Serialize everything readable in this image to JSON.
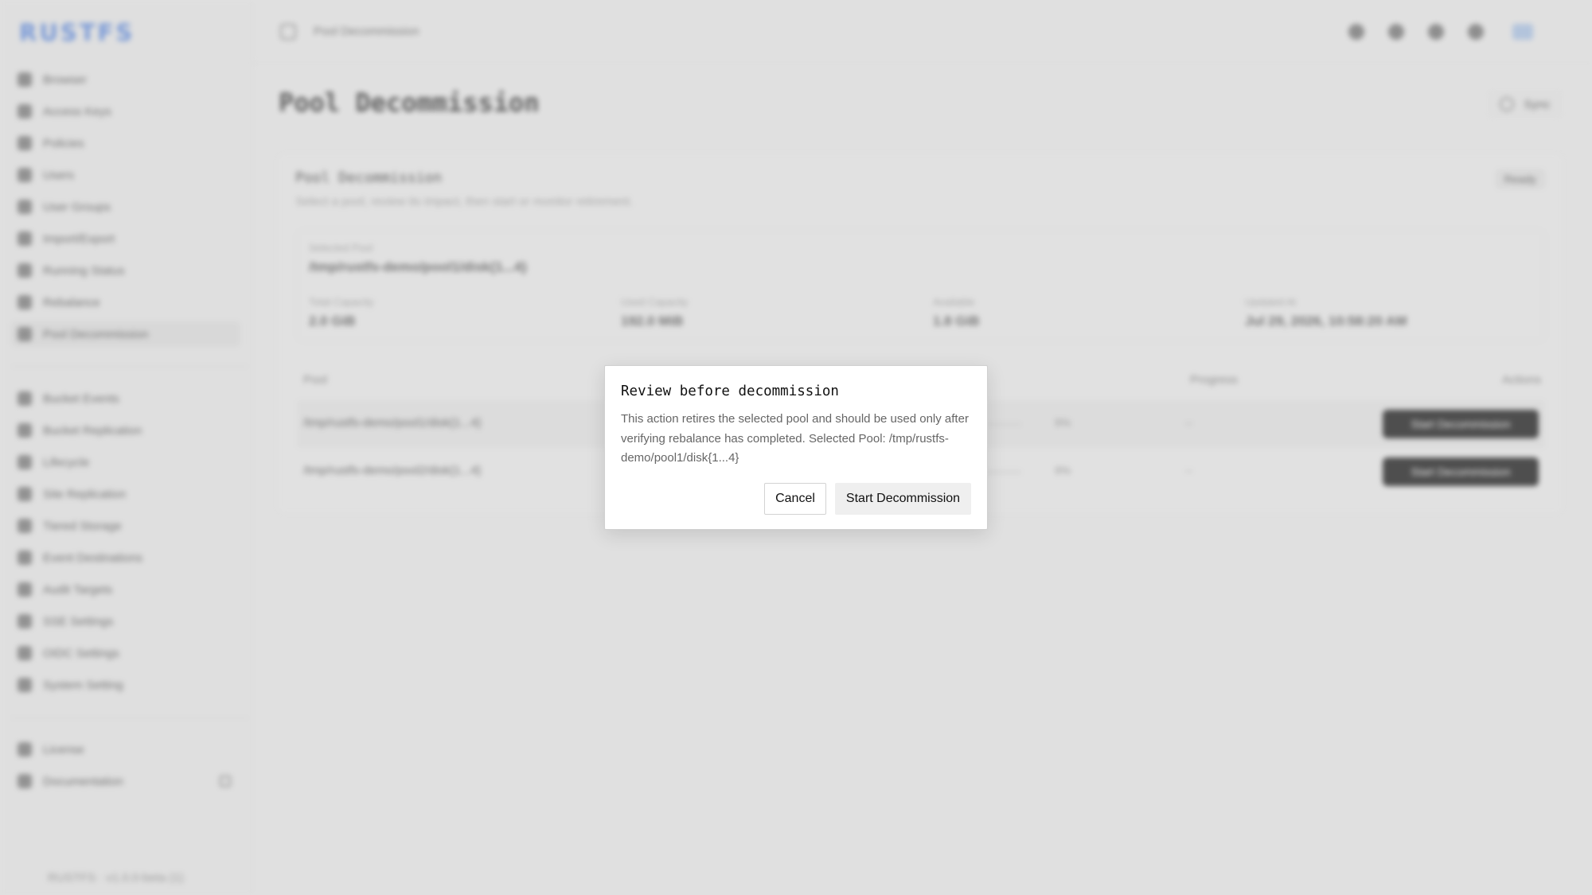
{
  "app": {
    "logo": "RUSTFS",
    "version": "RUSTFS · v1.0.0-beta (1)"
  },
  "sidebar": {
    "items": [
      {
        "label": "Browser"
      },
      {
        "label": "Access Keys"
      },
      {
        "label": "Policies"
      },
      {
        "label": "Users"
      },
      {
        "label": "User Groups"
      },
      {
        "label": "Import/Export"
      },
      {
        "label": "Running Status"
      },
      {
        "label": "Rebalance"
      },
      {
        "label": "Pool Decommission"
      },
      {
        "label": "Bucket Events"
      },
      {
        "label": "Bucket Replication"
      },
      {
        "label": "Lifecycle"
      },
      {
        "label": "Site Replication"
      },
      {
        "label": "Tiered Storage"
      },
      {
        "label": "Event Destinations"
      },
      {
        "label": "Audit Targets"
      },
      {
        "label": "SSE Settings"
      },
      {
        "label": "OIDC Settings"
      },
      {
        "label": "System Setting"
      },
      {
        "label": "License"
      },
      {
        "label": "Documentation"
      }
    ],
    "active_index": 8
  },
  "topbar": {
    "title": "Pool Decommission",
    "avatar": "EN"
  },
  "page": {
    "title": "Pool Decommission",
    "sync_label": "Sync"
  },
  "card": {
    "title": "Pool Decommission",
    "subtitle": "Select a pool, review its impact, then start or monitor retirement.",
    "badge": "Ready",
    "summary": {
      "selected_pool_label": "Selected Pool",
      "selected_pool_value": "/tmp/rustfs-demo/pool1/disk{1...4}",
      "total_capacity_label": "Total Capacity",
      "total_capacity_value": "2.0 GiB",
      "used_capacity_label": "Used Capacity",
      "used_capacity_value": "192.0 MiB",
      "available_label": "Available",
      "available_value": "1.8 GiB",
      "updated_label": "Updated At",
      "updated_value": "Jul 29, 2026, 10:58:20 AM"
    },
    "table": {
      "headers": {
        "pool": "Pool",
        "progress": "Progress",
        "actions": "Actions"
      },
      "rows": [
        {
          "pool": "/tmp/rustfs-demo/pool1/disk{1...4}",
          "usage": "9%",
          "progress": "--",
          "action": "Start Decommission"
        },
        {
          "pool": "/tmp/rustfs-demo/pool2/disk{1...4}",
          "usage": "9%",
          "progress": "--",
          "action": "Start Decommission"
        }
      ]
    }
  },
  "dialog": {
    "title": "Review before decommission",
    "body": "This action retires the selected pool and should be used only after verifying rebalance has completed. Selected Pool: /tmp/rustfs-demo/pool1/disk{1...4}",
    "cancel_label": "Cancel",
    "confirm_label": "Start Decommission"
  },
  "colors": {
    "background": "#e5e5e5",
    "dialog_bg": "#ffffff",
    "confirm_button_bg": "#efefef",
    "logo": "#5b86d8",
    "action_button": "#222222"
  }
}
